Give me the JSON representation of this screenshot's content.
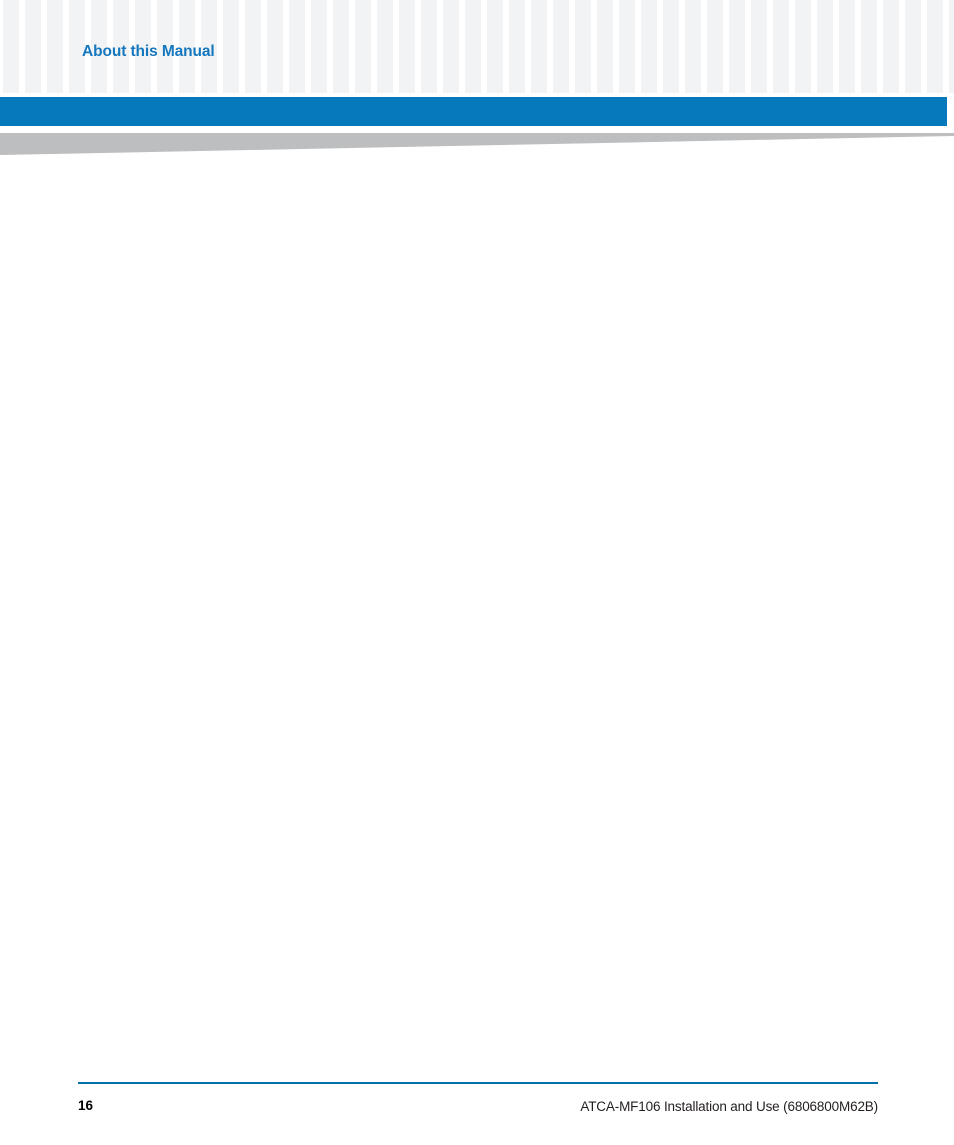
{
  "document": {
    "running_head": "About this Manual",
    "accent_blue": "#0579bc",
    "heading_blue": "#1577be",
    "wedge_gray": "#bcbec0",
    "pattern_gray": "#f2f3f4"
  },
  "body": {
    "content": ""
  },
  "footer": {
    "page_number": "16",
    "doc_title": "ATCA-MF106 Installation and Use (6806800M62B)",
    "rule_color": "#0070ad"
  }
}
